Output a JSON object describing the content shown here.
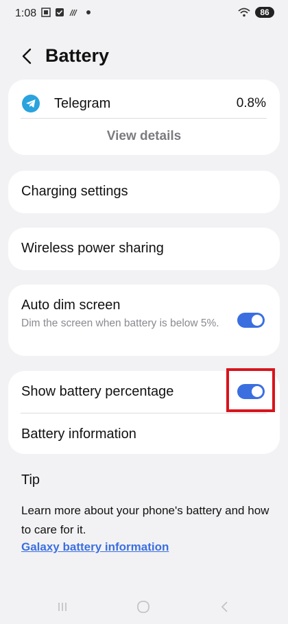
{
  "status_bar": {
    "time": "1:08",
    "battery_level": "86",
    "icons_left": [
      "screenshot-icon",
      "check-icon",
      "signal-slash-icon"
    ],
    "icons_right": [
      "wifi-icon",
      "battery-icon"
    ]
  },
  "header": {
    "title": "Battery"
  },
  "app_usage": {
    "app_name": "Telegram",
    "percent": "0.8%",
    "view_details": "View details"
  },
  "settings": {
    "charging": "Charging settings",
    "wireless": "Wireless power sharing",
    "auto_dim": {
      "title": "Auto dim screen",
      "subtitle": "Dim the screen when battery is below 5%.",
      "enabled": true
    },
    "show_percentage": {
      "title": "Show battery percentage",
      "enabled": true
    },
    "battery_info": "Battery information"
  },
  "tip": {
    "title": "Tip",
    "body": "Learn more about your phone's battery and how to care for it.",
    "link": "Galaxy battery information"
  },
  "colors": {
    "accent": "#3b6fe0",
    "highlight": "#d8141c",
    "background": "#f2f2f4",
    "card": "#ffffff"
  }
}
